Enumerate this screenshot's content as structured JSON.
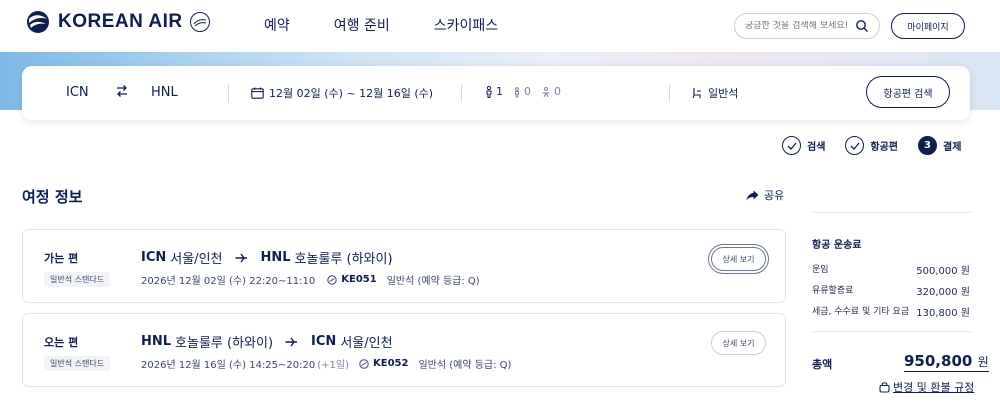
{
  "header": {
    "logo_text": "KOREAN AIR",
    "nav": [
      "예약",
      "여행 준비",
      "스카이패스"
    ],
    "search_placeholder": "궁금한 것을 검색해 보세요!",
    "mypage_label": "마이페이지"
  },
  "search_bar": {
    "origin": "ICN",
    "destination": "HNL",
    "dates": "12월 02일 (수) ~ 12월 16일 (수)",
    "adults": "1",
    "children": "0",
    "infants": "0",
    "cabin": "일반석",
    "search_button": "항공편 검색"
  },
  "steps": [
    {
      "label": "검색",
      "state": "done"
    },
    {
      "label": "항공편",
      "state": "done"
    },
    {
      "number": "3",
      "label": "결제",
      "state": "active"
    }
  ],
  "section": {
    "title": "여정 정보",
    "share_label": "공유"
  },
  "itinerary": [
    {
      "label": "가는 편",
      "badge": "일반석 스탠다드",
      "from_code": "ICN",
      "from_name": "서울/인천",
      "to_code": "HNL",
      "to_name": "호놀룰루 (하와이)",
      "date_time": "2026년 12월 02일 (수) 22:20~11:10",
      "plus_day": "",
      "flight_no": "KE051",
      "cabin": "일반석 (예약 등급: Q)",
      "details_label": "상세 보기"
    },
    {
      "label": "오는 편",
      "badge": "일반석 스탠다드",
      "from_code": "HNL",
      "from_name": "호놀룰루 (하와이)",
      "to_code": "ICN",
      "to_name": "서울/인천",
      "date_time": "2026년 12월 16일 (수) 14:25~20:20",
      "plus_day": "(+1일)",
      "flight_no": "KE052",
      "cabin": "일반석 (예약 등급: Q)",
      "details_label": "상세 보기"
    }
  ],
  "fare": {
    "title": "항공 운송료",
    "rows": [
      {
        "label": "운임",
        "value": "500,000 원"
      },
      {
        "label": "유류할증료",
        "value": "320,000 원"
      },
      {
        "label": "세금, 수수료 및 기타 요금",
        "value": "130,800 원"
      }
    ],
    "total_label": "총액",
    "total_amount": "950,800",
    "total_unit": "원",
    "rules_link": "변경 및 환불 규정"
  },
  "colors": {
    "brand_navy": "#0f1f4d",
    "border": "#e0e4ea"
  }
}
